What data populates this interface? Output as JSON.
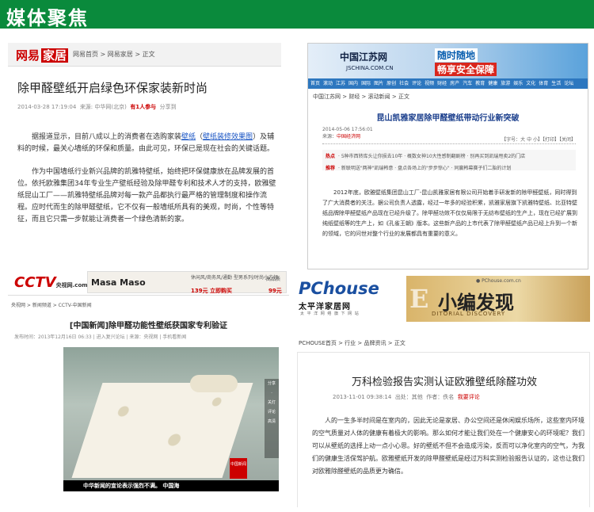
{
  "header": {
    "title": "媒体聚焦"
  },
  "p1": {
    "logo_a": "网易",
    "logo_b": "家居",
    "crumb": "网易首页 > 网易家居 > 正文",
    "title": "除甲醛壁纸开启绿色环保家装新时尚",
    "meta_date": "2014-03-28 17:19:04",
    "meta_source": "来源: 中华网(北京)",
    "meta_share": "有1人参与",
    "meta_share2": "分享到",
    "body1_a": "据报道显示，目前八成以上的消费者在选购家装",
    "body1_link1": "壁纸",
    "body1_b": "（",
    "body1_link2": "壁纸装修效果图",
    "body1_c": "）及辅料的时候，最关心墙纸的环保和质量。由此可见，环保已是现在社会的关键话题。",
    "body2": "作为中国墙纸行业新兴品牌的凯雅特壁纸，始终把环保健康放在品牌发展的首位。依托欧雅集团34年专业生产壁纸经验及除甲醛专利和技术人才的支持，欧雅壁纸昆山工厂——凯雅特壁纸品牌对每一款产品都执行最严格的管理制度和操作流程。应时代而生的除甲醛壁纸，它不仅有一般墙纸所具有的美观，时尚，个性等特征，而且它只需一步就能让消费者一个绿色清新的家。"
  },
  "p2": {
    "logo": "中国江苏网",
    "url": "JSCHINA.COM.CN",
    "slogan1": "随时随地",
    "slogan2": "畅享安全保障",
    "nav": [
      "首页",
      "滚动",
      "江苏",
      "国内",
      "国际",
      "图片",
      "原创",
      "社会",
      "评论",
      "视频",
      "财经",
      "房产",
      "汽车",
      "教育",
      "健康",
      "旅游",
      "娱乐",
      "文化",
      "体育",
      "生活",
      "论坛"
    ],
    "crumb": "中国江苏网 > 财经 > 滚动新闻 > 正文",
    "title": "昆山凯雅家居除甲醛壁纸带动行业新突破",
    "meta_date": "2014-05-06 17:56:01",
    "meta_source_label": "来源：",
    "meta_source": "中国经济网",
    "meta_tools": "【字号：大 中 小】【打印】【关闭】",
    "hot_label": "热点",
    "hot1": "· 5种市西转库头让你损去10年    · 概数女神10大性感制翻剧榜    · 别再买到凯瑞甩卖2的门店",
    "recommend_label": "推荐",
    "hot2": "· 新联明送\"两神\"凯瑞韩意    · 盘点各场上的\"步步惊心\"    · 同赢韩幕赛子们二胎的计划",
    "body1": "2012年底，欧雅壁纸集团昆山工厂-昆山凯雅家居有限公司开始着手研发新的除甲醛壁纸，同时得到了广大消费者的关注。据公司负责人透露，经过一年多的经验积累，凯雅家居旗下凯雅特壁纸、比亚特壁纸品牌除甲醛壁纸产品现在已经升级了。除甲醛功效不仅仅局限于无纺布壁纸的生产上，现在已经扩展到纯纸壁纸等的生产上，如《孔雀王朝》版本。这些新产品的上市代表了除甲醛壁纸产品已经上升到一个新的领域，它的问世对整个行业的发展都具有重要的意义。"
  },
  "p3": {
    "cctv": "CCTV",
    "cctv_sub": "央视网",
    "cctv_dot": ".com",
    "ad_brand": "Masa Maso",
    "ad_text": "休闲风/商务风/通勤\n型男系列/时尚小方领",
    "ad_price": "139元 立即购买",
    "ad_text2": "高品质",
    "ad_price2": "99元",
    "crumb": "央视网 > 新闻频道 > CCTV-中国新闻",
    "title": "[中国新闻]除甲醛功能性壁纸获国家专利验证",
    "meta": "发布时间：2013年12月16日 06:33 | 进入复兴论坛 | 来源：央视网 | 手机看新闻",
    "sidebar": [
      "分享",
      "·",
      "关灯",
      "评论",
      "高清"
    ],
    "badge": "中国新闻",
    "caption": "中华新闻的宣论表示强烈不满。          中国海"
  },
  "p4": {
    "logo": "PChouse",
    "logo_suffix": ".com.cn",
    "logo_cn": "太平洋家居网",
    "logo_sub": "太 平 洋 网 络 旗 下 网 站",
    "banner_url": "● PChouse.com.cn",
    "banner_big": "小编发现",
    "banner_e": "E",
    "banner_sub": "DITORIAL DISCOVERY",
    "crumb": "PCHOUSE首页 > 行业 > 品牌资讯 > 正文",
    "title": "万科检验报告实测认证欧雅壁纸除醛功效",
    "meta_date": "2013-11-01 09:38:14",
    "meta_from": "出处：其他",
    "meta_author": "作者：佚名",
    "meta_review": "我要评论",
    "body": "人的一生多半时间是在室内的，因此无论是家居、办公空间还是休闲娱乐场所，这些室内环境的空气质量对人体的健康有着极大的影响。那么如何才能让我们处在一个健康安心的环境呢？我们可以从壁纸的选择上动一点小心思。好的壁纸不但不会造成污染，反而可以净化室内的空气，为我们的健康生活保驾护航。欧雅壁纸开发的除甲醛壁纸是经过万科实测检验报告认证的，这也让我们对欧雅除醛壁纸的品质更为确信。"
  }
}
